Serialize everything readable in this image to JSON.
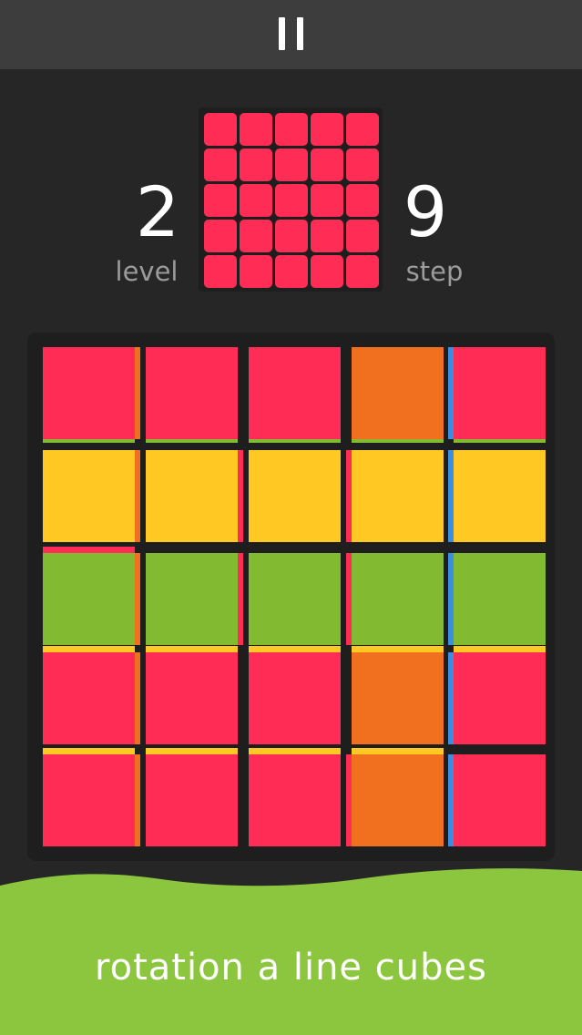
{
  "header": {
    "pause_icon": "pause-icon"
  },
  "stats": {
    "level_value": "2",
    "level_label": "level",
    "step_value": "9",
    "step_label": "step"
  },
  "colors": {
    "red": "#ff2d55",
    "orange": "#f07020",
    "yellow": "#ffc823",
    "green": "#82bb32",
    "blue": "#3c8ee0",
    "background": "#262627",
    "panel": "#1e1e1f",
    "ground": "#8cc63f"
  },
  "target_pattern": {
    "rows": [
      [
        "red",
        "red",
        "red",
        "red",
        "red"
      ],
      [
        "red",
        "red",
        "red",
        "red",
        "red"
      ],
      [
        "red",
        "red",
        "red",
        "red",
        "red"
      ],
      [
        "red",
        "red",
        "red",
        "red",
        "red"
      ],
      [
        "red",
        "red",
        "red",
        "red",
        "red"
      ]
    ]
  },
  "board": {
    "rows": [
      [
        {
          "face": "red",
          "right": "orange",
          "bottom": "green"
        },
        {
          "face": "red",
          "right": "",
          "bottom": "green"
        },
        {
          "face": "red",
          "right": "",
          "bottom": "green"
        },
        {
          "face": "orange",
          "right": "",
          "bottom": "green"
        },
        {
          "face": "red",
          "left": "blue",
          "bottom": "green"
        }
      ],
      [
        {
          "face": "yellow",
          "right": "orange"
        },
        {
          "face": "yellow",
          "right": "red"
        },
        {
          "face": "yellow"
        },
        {
          "face": "yellow",
          "left": "red"
        },
        {
          "face": "yellow",
          "left": "blue"
        }
      ],
      [
        {
          "face": "green",
          "right": "orange",
          "top": "red"
        },
        {
          "face": "green",
          "right": "red"
        },
        {
          "face": "green"
        },
        {
          "face": "green",
          "left": "red"
        },
        {
          "face": "green",
          "left": "blue"
        }
      ],
      [
        {
          "face": "red",
          "right": "orange",
          "top": "yellow"
        },
        {
          "face": "red",
          "top": "yellow"
        },
        {
          "face": "red",
          "top": "yellow"
        },
        {
          "face": "orange",
          "top": "yellow"
        },
        {
          "face": "red",
          "left": "blue",
          "top": "yellow"
        }
      ],
      [
        {
          "face": "red",
          "right": "orange",
          "top": "yellow"
        },
        {
          "face": "red",
          "top": "yellow"
        },
        {
          "face": "red",
          "top": "yellow"
        },
        {
          "face": "orange",
          "top": "yellow",
          "left": "red"
        },
        {
          "face": "red",
          "left": "blue"
        }
      ]
    ]
  },
  "footer": {
    "caption": "rotation a line cubes"
  }
}
